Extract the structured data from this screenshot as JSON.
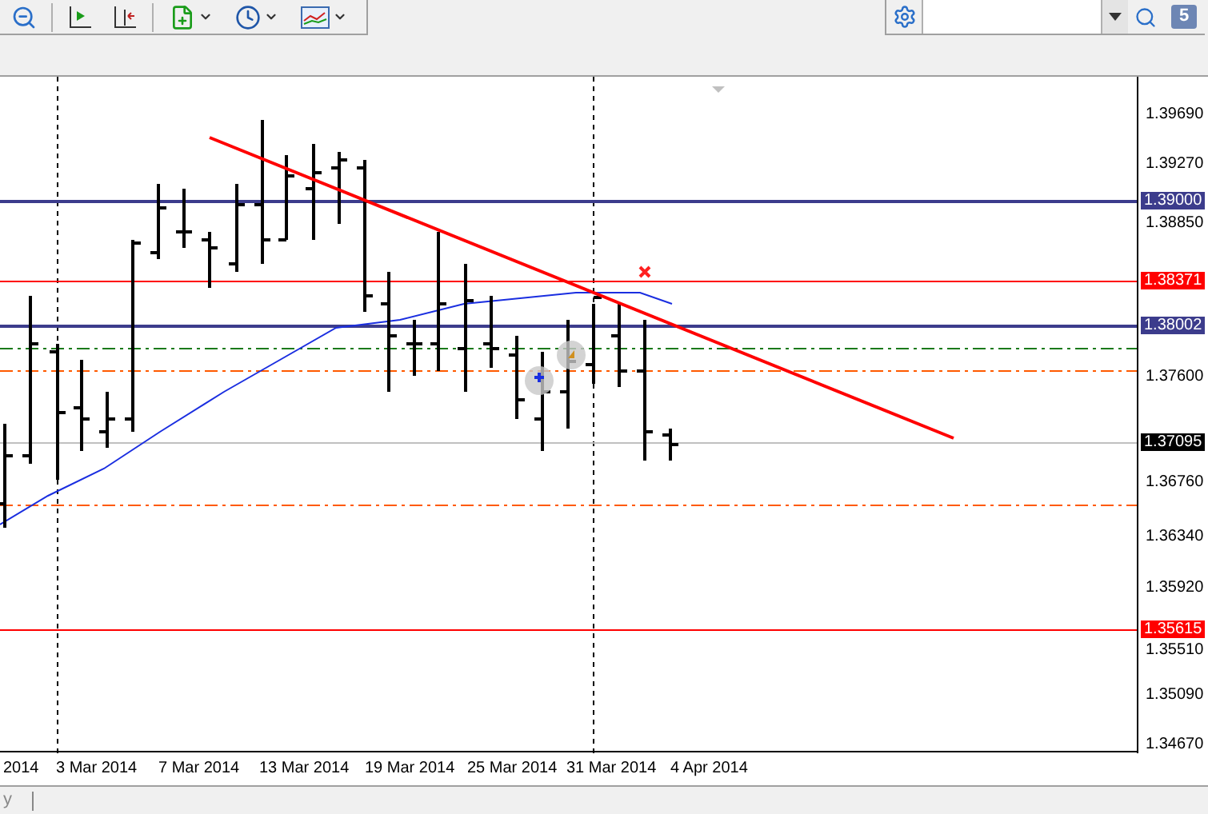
{
  "toolbar": {
    "messages_badge": "5"
  },
  "price_axis": {
    "ticks": [
      "1.39690",
      "1.39270",
      "1.38850",
      "1.37600",
      "1.36760",
      "1.36340",
      "1.35920",
      "1.35510",
      "1.35090",
      "1.34670"
    ],
    "markers": [
      {
        "label": "1.39000",
        "color": "#3c3c8c"
      },
      {
        "label": "1.38371",
        "color": "#ff0000"
      },
      {
        "label": "1.38002",
        "color": "#3c3c8c"
      },
      {
        "label": "1.37095",
        "color": "#000000"
      },
      {
        "label": "1.35615",
        "color": "#ff0000"
      }
    ]
  },
  "time_axis": {
    "labels": [
      "2014",
      "3 Mar 2014",
      "7 Mar 2014",
      "13 Mar 2014",
      "19 Mar 2014",
      "25 Mar 2014",
      "31 Mar 2014",
      "4 Apr 2014"
    ]
  },
  "status_bar": {
    "text": "y"
  }
}
